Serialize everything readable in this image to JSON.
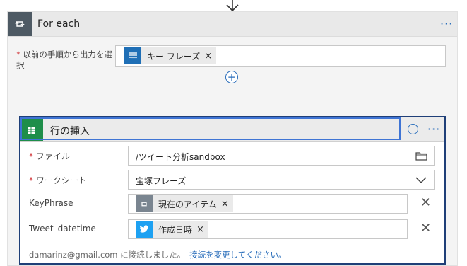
{
  "foreach": {
    "title": "For each",
    "more_label": "···",
    "required_star": "*",
    "select_label": "以前の手順から出力を選択",
    "selected_token": {
      "label": "キー フレーズ",
      "remove": "×",
      "icon": "list-icon"
    },
    "add_label": "+"
  },
  "insert_row": {
    "title": "行の挿入",
    "info_label": "i",
    "more_label": "···",
    "fields": {
      "file": {
        "label": "ファイル",
        "required": "*",
        "value": "/ツイート分析sandbox",
        "icon": "folder-icon"
      },
      "worksheet": {
        "label": "ワークシート",
        "required": "*",
        "value": "宝塚フレーズ",
        "icon": "chevron-down-icon"
      },
      "keyphrase": {
        "label": "KeyPhrase",
        "token": "現在のアイテム",
        "remove": "×",
        "clear": "✕",
        "icon": "loop-icon"
      },
      "tweet_datetime": {
        "label": "Tweet_datetime",
        "token": "作成日時",
        "remove": "×",
        "clear": "✕",
        "icon": "twitter-icon"
      }
    },
    "connection": {
      "text": "damarinz@gmail.com に接続しました。",
      "link": "接続を変更してください。"
    }
  },
  "colors": {
    "accent": "#2a6ebb",
    "foreach_icon_bg": "#4e5a64",
    "sheets_green": "#1e8e4a",
    "twitter_blue": "#1da1f2",
    "list_blue": "#1f6fb6",
    "required_red": "#d13438",
    "card_border": "#1f3f78"
  }
}
